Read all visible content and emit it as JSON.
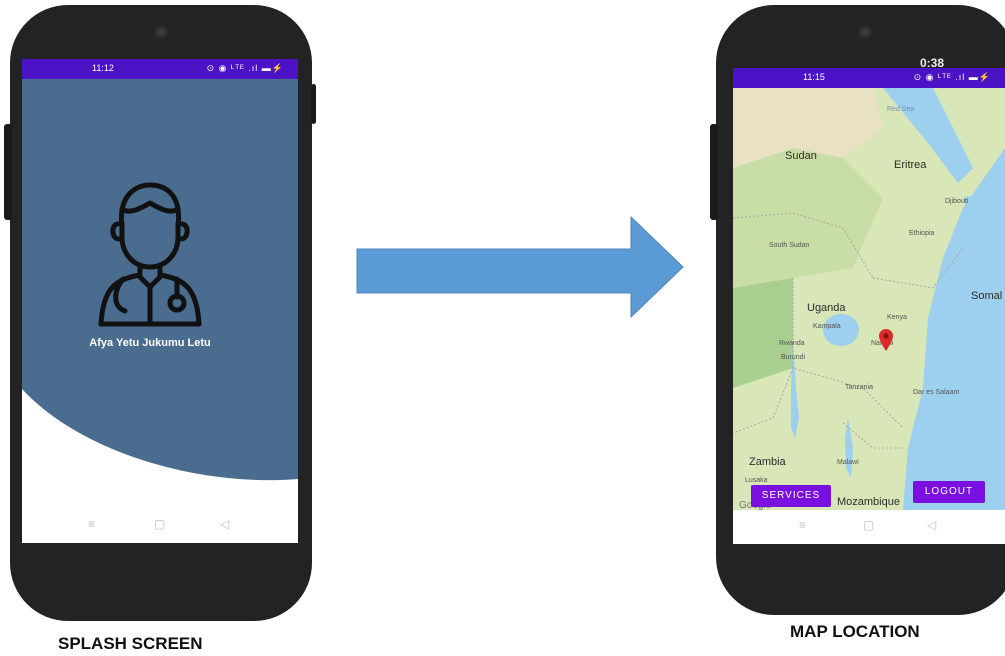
{
  "left_phone": {
    "status_time": "11:12",
    "status_icons": "⊙ ◉ ᴸᵀᴱ .ıl ▬⚡",
    "tagline": "Afya Yetu  Jukumu Letu",
    "nav": {
      "menu": "≡",
      "home": "▢",
      "back": "◁"
    },
    "colors": {
      "screen_bg": "#4a6c8f",
      "status_bar": "#4c12c6"
    }
  },
  "right_phone": {
    "status_time": "11:15",
    "status_icons": "⊙ ◉ ᴸᵀᴱ .ıl ▬⚡",
    "top_clock": "0:38",
    "map_labels": {
      "red_sea": "Red Sea",
      "sudan": "Sudan",
      "eritrea": "Eritrea",
      "djibouti": "Djibouti",
      "ethiopia": "Ethiopia",
      "south_sudan": "South Sudan",
      "somalia": "Somal",
      "uganda": "Uganda",
      "kampala": "Kampala",
      "kenya": "Kenya",
      "nairobi": "Nairobi",
      "rwanda": "Rwanda",
      "burundi": "Burundi",
      "tanzania": "Tanzania",
      "dar": "Dar es Salaam",
      "zambia": "Zambia",
      "lusaka": "Lusaka",
      "malawi": "Malawi",
      "mozambique": "Mozambique",
      "google": "Google"
    },
    "buttons": {
      "services": "SERVICES",
      "logout": "LOGOUT"
    },
    "nav": {
      "menu": "≡",
      "home": "▢",
      "back": "◁"
    }
  },
  "captions": {
    "left": "SPLASH SCREEN",
    "right": "MAP LOCATION"
  },
  "arrow_color": "#5b9bd5"
}
